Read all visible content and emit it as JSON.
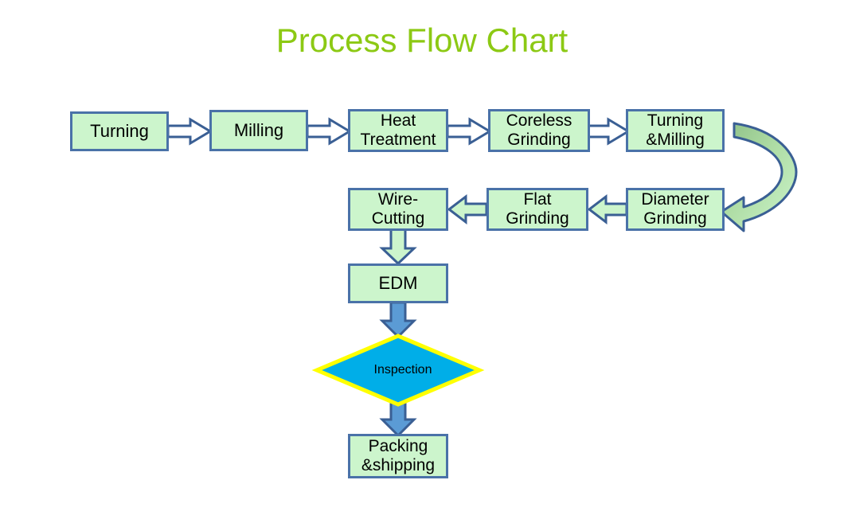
{
  "title": "Process Flow Chart",
  "theme": {
    "title_color": "#8CC914",
    "node_fill": "#CCF5CC",
    "node_stroke": "#4A72A8",
    "arrow_outline_fill": "#FFFFFF",
    "arrow_green_fill": "#CCF5CC",
    "arrow_blue_fill": "#5B9BD5",
    "arrow_stroke": "#3A5F94",
    "diamond_fill": "#00AEE8",
    "diamond_stroke": "#FFFF00",
    "background": "#FFFFFF"
  },
  "nodes": [
    {
      "id": "turning",
      "label": "Turning"
    },
    {
      "id": "milling",
      "label": "Milling"
    },
    {
      "id": "heat-treatment",
      "label": "Heat\nTreatment"
    },
    {
      "id": "coreless-grinding",
      "label": "Coreless\nGrinding"
    },
    {
      "id": "turning-milling",
      "label": "Turning\n&Milling"
    },
    {
      "id": "diameter-grinding",
      "label": "Diameter\nGrinding"
    },
    {
      "id": "flat-grinding",
      "label": "Flat\nGrinding"
    },
    {
      "id": "wire-cutting",
      "label": "Wire-\nCutting"
    },
    {
      "id": "edm",
      "label": "EDM"
    },
    {
      "id": "inspection",
      "label": "Inspection"
    },
    {
      "id": "packing-shipping",
      "label": "Packing\n&shipping"
    }
  ],
  "connectors": [
    {
      "id": "turning-to-milling",
      "from": "turning",
      "to": "milling",
      "style": "outline",
      "direction": "right"
    },
    {
      "id": "milling-to-heat-treatment",
      "from": "milling",
      "to": "heat-treatment",
      "style": "outline",
      "direction": "right"
    },
    {
      "id": "heat-treatment-to-coreless-grinding",
      "from": "heat-treatment",
      "to": "coreless-grinding",
      "style": "outline",
      "direction": "right"
    },
    {
      "id": "coreless-grinding-to-turning-milling",
      "from": "coreless-grinding",
      "to": "turning-milling",
      "style": "outline",
      "direction": "right"
    },
    {
      "id": "turning-milling-to-diameter-grinding",
      "from": "turning-milling",
      "to": "diameter-grinding",
      "style": "curved",
      "direction": "down-left"
    },
    {
      "id": "diameter-grinding-to-flat-grinding",
      "from": "diameter-grinding",
      "to": "flat-grinding",
      "style": "green",
      "direction": "left"
    },
    {
      "id": "flat-grinding-to-wire-cutting",
      "from": "flat-grinding",
      "to": "wire-cutting",
      "style": "green",
      "direction": "left"
    },
    {
      "id": "wire-cutting-to-edm",
      "from": "wire-cutting",
      "to": "edm",
      "style": "green",
      "direction": "down"
    },
    {
      "id": "edm-to-inspection",
      "from": "edm",
      "to": "inspection",
      "style": "blue",
      "direction": "down"
    },
    {
      "id": "inspection-to-packing-shipping",
      "from": "inspection",
      "to": "packing-shipping",
      "style": "blue",
      "direction": "down"
    }
  ]
}
